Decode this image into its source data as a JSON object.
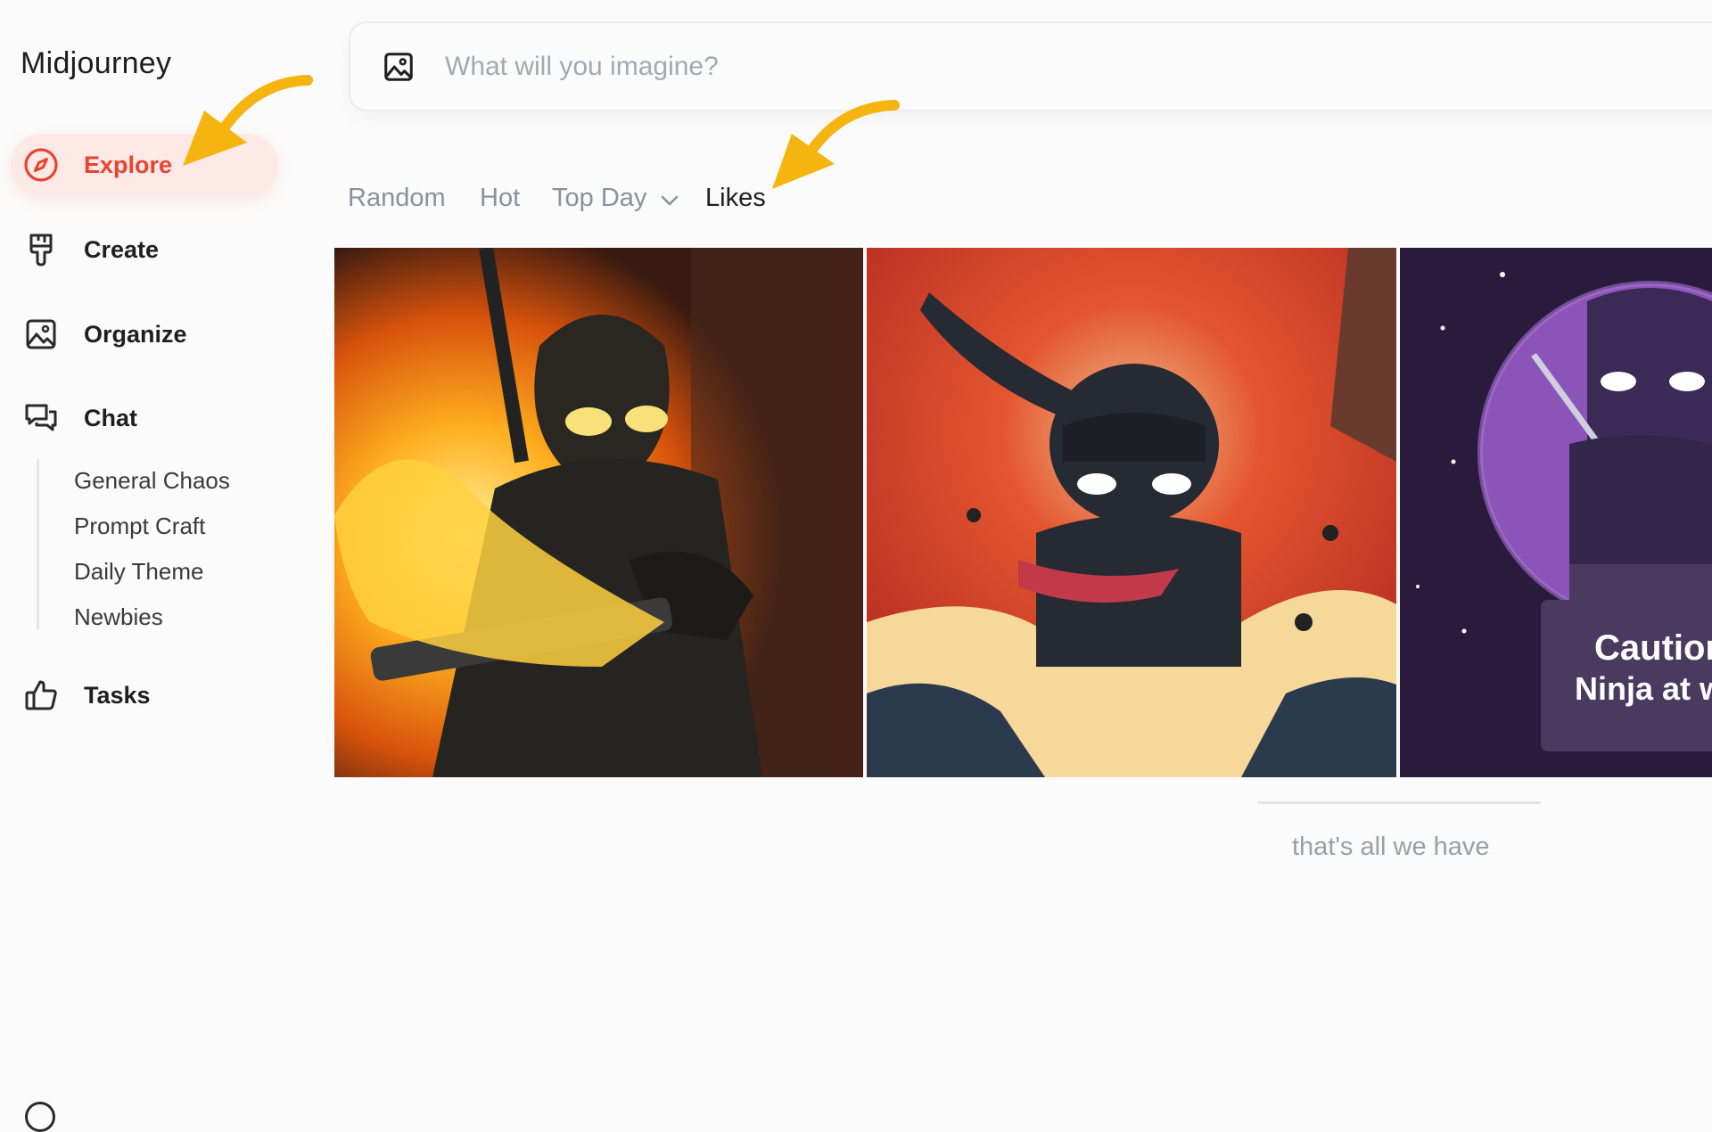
{
  "app": {
    "title": "Midjourney"
  },
  "sidebar": {
    "items": [
      {
        "label": "Explore",
        "icon": "compass-icon",
        "active": true
      },
      {
        "label": "Create",
        "icon": "paintbrush-icon"
      },
      {
        "label": "Organize",
        "icon": "image-icon"
      },
      {
        "label": "Chat",
        "icon": "chat-bubbles-icon"
      },
      {
        "label": "Tasks",
        "icon": "thumbs-up-icon"
      }
    ],
    "chat_rooms": [
      "General Chaos",
      "Prompt Craft",
      "Daily Theme",
      "Newbies"
    ]
  },
  "search": {
    "placeholder": "What will you imagine?",
    "icon": "image-icon",
    "value": ""
  },
  "tabs": [
    {
      "label": "Random"
    },
    {
      "label": "Hot"
    },
    {
      "label": "Top Day",
      "has_dropdown": true
    },
    {
      "label": "Likes",
      "active": true
    }
  ],
  "gallery": {
    "images": [
      {
        "description": "ninja-with-flaming-sword"
      },
      {
        "description": "ninja-leaping-explosion"
      },
      {
        "description": "ninja-purple-moon",
        "caption_lines": [
          "Caution",
          "Ninja at w"
        ]
      }
    ],
    "end_text": "that's all we have"
  },
  "colors": {
    "accent": "#e9442f",
    "accent_bg": "#fde9e6",
    "annotation_arrow": "#f5b40f",
    "tab_inactive": "#8a90a0"
  }
}
